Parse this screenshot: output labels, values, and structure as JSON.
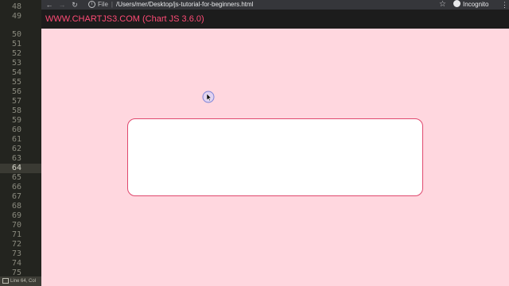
{
  "editor": {
    "line_numbers": [
      "48",
      "49",
      "50",
      "51",
      "52",
      "53",
      "54",
      "55",
      "56",
      "57",
      "58",
      "59",
      "60",
      "61",
      "62",
      "63",
      "64",
      "65",
      "66",
      "67",
      "68",
      "69",
      "70",
      "71",
      "72",
      "73",
      "74",
      "75"
    ],
    "active_line": "64",
    "status_text": "Line 64, Col"
  },
  "browser": {
    "nav": {
      "back": "←",
      "forward": "→",
      "reload": "↻"
    },
    "address": {
      "scheme_label": "File",
      "url": "/Users/mer/Desktop/js-tutorial-for-beginners.html"
    },
    "bookmark_icon": "star-icon",
    "profile": {
      "label": "Incognito",
      "icon": "incognito-icon"
    },
    "menu_icon": "kebab-menu-icon"
  },
  "page": {
    "header_title": "WWW.CHARTJS3.COM (Chart JS 3.6.0)",
    "colors": {
      "page_background": "#ffd7df",
      "header_background": "#1c1c1c",
      "header_text": "#ff4b76",
      "card_border": "#e0486e",
      "card_background": "#ffffff"
    }
  }
}
